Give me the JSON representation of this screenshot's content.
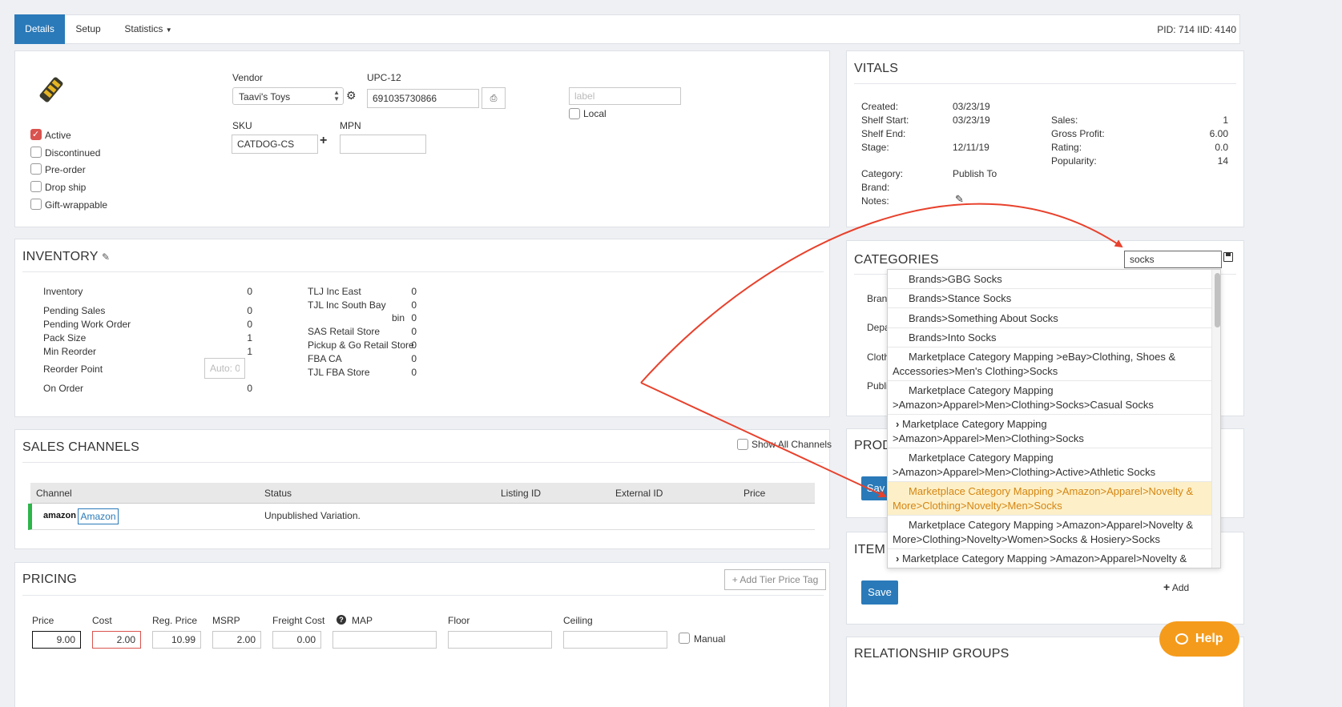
{
  "tabs": [
    "Details",
    "Setup",
    "Statistics"
  ],
  "pid_label": "PID: 714 IID: 4140",
  "details": {
    "checkboxes": [
      {
        "label": "Active",
        "checked": true
      },
      {
        "label": "Discontinued",
        "checked": false
      },
      {
        "label": "Pre-order",
        "checked": false
      },
      {
        "label": "Drop ship",
        "checked": false
      },
      {
        "label": "Gift-wrappable",
        "checked": false
      }
    ],
    "vendor_label": "Vendor",
    "vendor_value": "Taavi's Toys",
    "upc_label": "UPC-12",
    "upc_value": "691035730866",
    "sku_label": "SKU",
    "sku_value": "CATDOG-CS",
    "mpn_label": "MPN",
    "mpn_value": "",
    "label_placeholder": "label",
    "local_label": "Local"
  },
  "vitals": {
    "title": "VITALS",
    "left": [
      {
        "k": "Created:",
        "v": "03/23/19"
      },
      {
        "k": "Shelf Start:",
        "v": "03/23/19"
      },
      {
        "k": "Shelf End:",
        "v": ""
      },
      {
        "k": "Stage:",
        "v": "12/11/19"
      }
    ],
    "right": [
      {
        "k": "Sales:",
        "v": "1"
      },
      {
        "k": "Gross Profit:",
        "v": "6.00"
      },
      {
        "k": "Rating:",
        "v": "0.0"
      },
      {
        "k": "Popularity:",
        "v": "14"
      }
    ],
    "category_label": "Category:",
    "category_value": "Publish To",
    "brand_label": "Brand:",
    "notes_label": "Notes:"
  },
  "inventory": {
    "title": "INVENTORY",
    "left": [
      {
        "k": "Inventory",
        "v": "0"
      },
      {
        "k": "Pending Sales",
        "v": "0"
      },
      {
        "k": "Pending Work Order",
        "v": "0"
      },
      {
        "k": "Pack Size",
        "v": "1"
      },
      {
        "k": "Min Reorder",
        "v": "1"
      },
      {
        "k": "Reorder Point",
        "v": ""
      },
      {
        "k": "On Order",
        "v": "0"
      }
    ],
    "reorder_auto": "Auto: 0",
    "locations": [
      {
        "k": "TLJ Inc East",
        "v": "0"
      },
      {
        "k": "TJL Inc South Bay",
        "v": "0"
      },
      {
        "k": "bin",
        "v": "0"
      },
      {
        "k": "SAS Retail Store",
        "v": "0"
      },
      {
        "k": "Pickup & Go Retail Store",
        "v": "0"
      },
      {
        "k": "FBA CA",
        "v": "0"
      },
      {
        "k": "TJL FBA Store",
        "v": "0"
      }
    ]
  },
  "sales_channels": {
    "title": "SALES CHANNELS",
    "show_all": "Show All Channels",
    "columns": [
      "Channel",
      "Status",
      "Listing ID",
      "External ID",
      "Price"
    ],
    "row": {
      "logo": "amazon",
      "channel": "Amazon",
      "status": "Unpublished Variation."
    }
  },
  "pricing": {
    "title": "PRICING",
    "add_tier": "Add Tier Price Tag",
    "fields": [
      {
        "label": "Price",
        "value": "9.00"
      },
      {
        "label": "Cost",
        "value": "2.00"
      },
      {
        "label": "Reg. Price",
        "value": "10.99"
      },
      {
        "label": "MSRP",
        "value": "2.00"
      },
      {
        "label": "Freight Cost",
        "value": "0.00"
      },
      {
        "label": "MAP",
        "value": ""
      },
      {
        "label": "Floor",
        "value": ""
      },
      {
        "label": "Ceiling",
        "value": ""
      }
    ],
    "manual": "Manual"
  },
  "categories": {
    "title": "CATEGORIES",
    "search_value": "socks",
    "behind": [
      "Bran",
      "Depa",
      "Cloth",
      "Publi"
    ],
    "results": [
      {
        "text": "Brands>GBG Socks",
        "chevron": false,
        "highlight": false
      },
      {
        "text": "Brands>Stance Socks",
        "chevron": false,
        "highlight": false
      },
      {
        "text": "Brands>Something About Socks",
        "chevron": false,
        "highlight": false
      },
      {
        "text": "Brands>Into Socks",
        "chevron": false,
        "highlight": false
      },
      {
        "l1": "Marketplace Category Mapping >eBay>Clothing, Shoes &",
        "l2": "Accessories>Men's Clothing>Socks",
        "chevron": false,
        "highlight": false
      },
      {
        "l1": "Marketplace Category Mapping",
        "l2": ">Amazon>Apparel>Men>Clothing>Socks>Casual Socks",
        "chevron": false,
        "highlight": false
      },
      {
        "l1": "Marketplace Category Mapping",
        "l2": ">Amazon>Apparel>Men>Clothing>Socks",
        "chevron": true,
        "highlight": false
      },
      {
        "l1": "Marketplace Category Mapping",
        "l2": ">Amazon>Apparel>Men>Clothing>Active>Athletic Socks",
        "chevron": false,
        "highlight": false
      },
      {
        "l1": "Marketplace Category Mapping >Amazon>Apparel>Novelty &",
        "l2": "More>Clothing>Novelty>Men>Socks",
        "chevron": false,
        "highlight": true
      },
      {
        "l1": "Marketplace Category Mapping >Amazon>Apparel>Novelty &",
        "l2": "More>Clothing>Novelty>Women>Socks & Hosiery>Socks",
        "chevron": false,
        "highlight": false
      },
      {
        "text": "Marketplace Category Mapping >Amazon>Apparel>Novelty &",
        "chevron": true,
        "highlight": false
      }
    ]
  },
  "prod_title": "PROD",
  "item_title": "ITEM I",
  "save_label": "Save",
  "sav_label": "Sav",
  "add_label": "Add",
  "relationship_title": "RELATIONSHIP GROUPS",
  "help_label": "Help",
  "colors": {
    "brand_blue": "#2a7ab9",
    "annotation_red": "#e8412c",
    "help_orange": "#f59b1b",
    "highlight_bg": "#fdf0c8"
  }
}
